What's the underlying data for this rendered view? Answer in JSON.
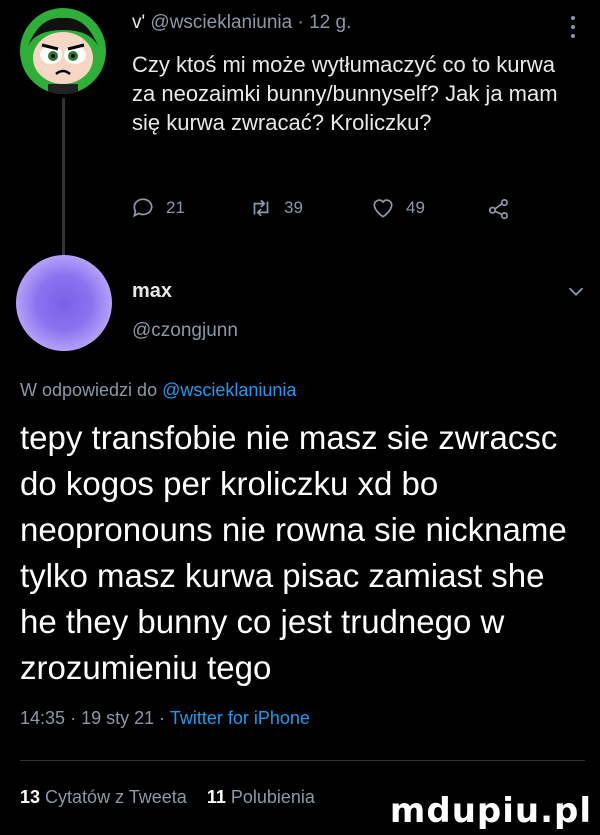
{
  "reply_tweet": {
    "badge": "v'",
    "handle": "@wscieklaniunia",
    "separator": "·",
    "time": "12 g.",
    "text": "Czy ktoś mi może wytłumaczyć co to kurwa za neozaimki bunny/bunnyself? Jak ja mam się kurwa zwracać? Kroliczku?",
    "actions": {
      "replies": "21",
      "retweets": "39",
      "likes": "49"
    },
    "icons": {
      "reply": "speech-bubble-icon",
      "retweet": "retweet-icon",
      "like": "heart-icon",
      "share": "share-icon"
    }
  },
  "author": {
    "display_name": "max",
    "username": "@czongjunn"
  },
  "reply_context": {
    "prefix": "W odpowiedzi do",
    "mention": "@wscieklaniunia"
  },
  "tweet": {
    "text": "tepy transfobie nie masz sie zwracsc do kogos per kroliczku xd bo neopronouns nie rowna sie nickname tylko masz kurwa pisac zamiast she he they bunny co jest trudnego w zrozumieniu tego",
    "time": "14:35",
    "date": "19 sty 21",
    "separator": "·",
    "source": "Twitter for iPhone"
  },
  "stats": {
    "quotes_count": "13",
    "quotes_label": "Cytatów z Tweeta",
    "likes_count": "11",
    "likes_label": "Polubienia"
  },
  "watermark": "mdupiu.pl",
  "colors": {
    "background": "#000000",
    "muted": "#8b98a5",
    "link": "#1d9bf0",
    "avatar_green": "#2fae3a",
    "avatar_purple": "#7b61e8"
  }
}
